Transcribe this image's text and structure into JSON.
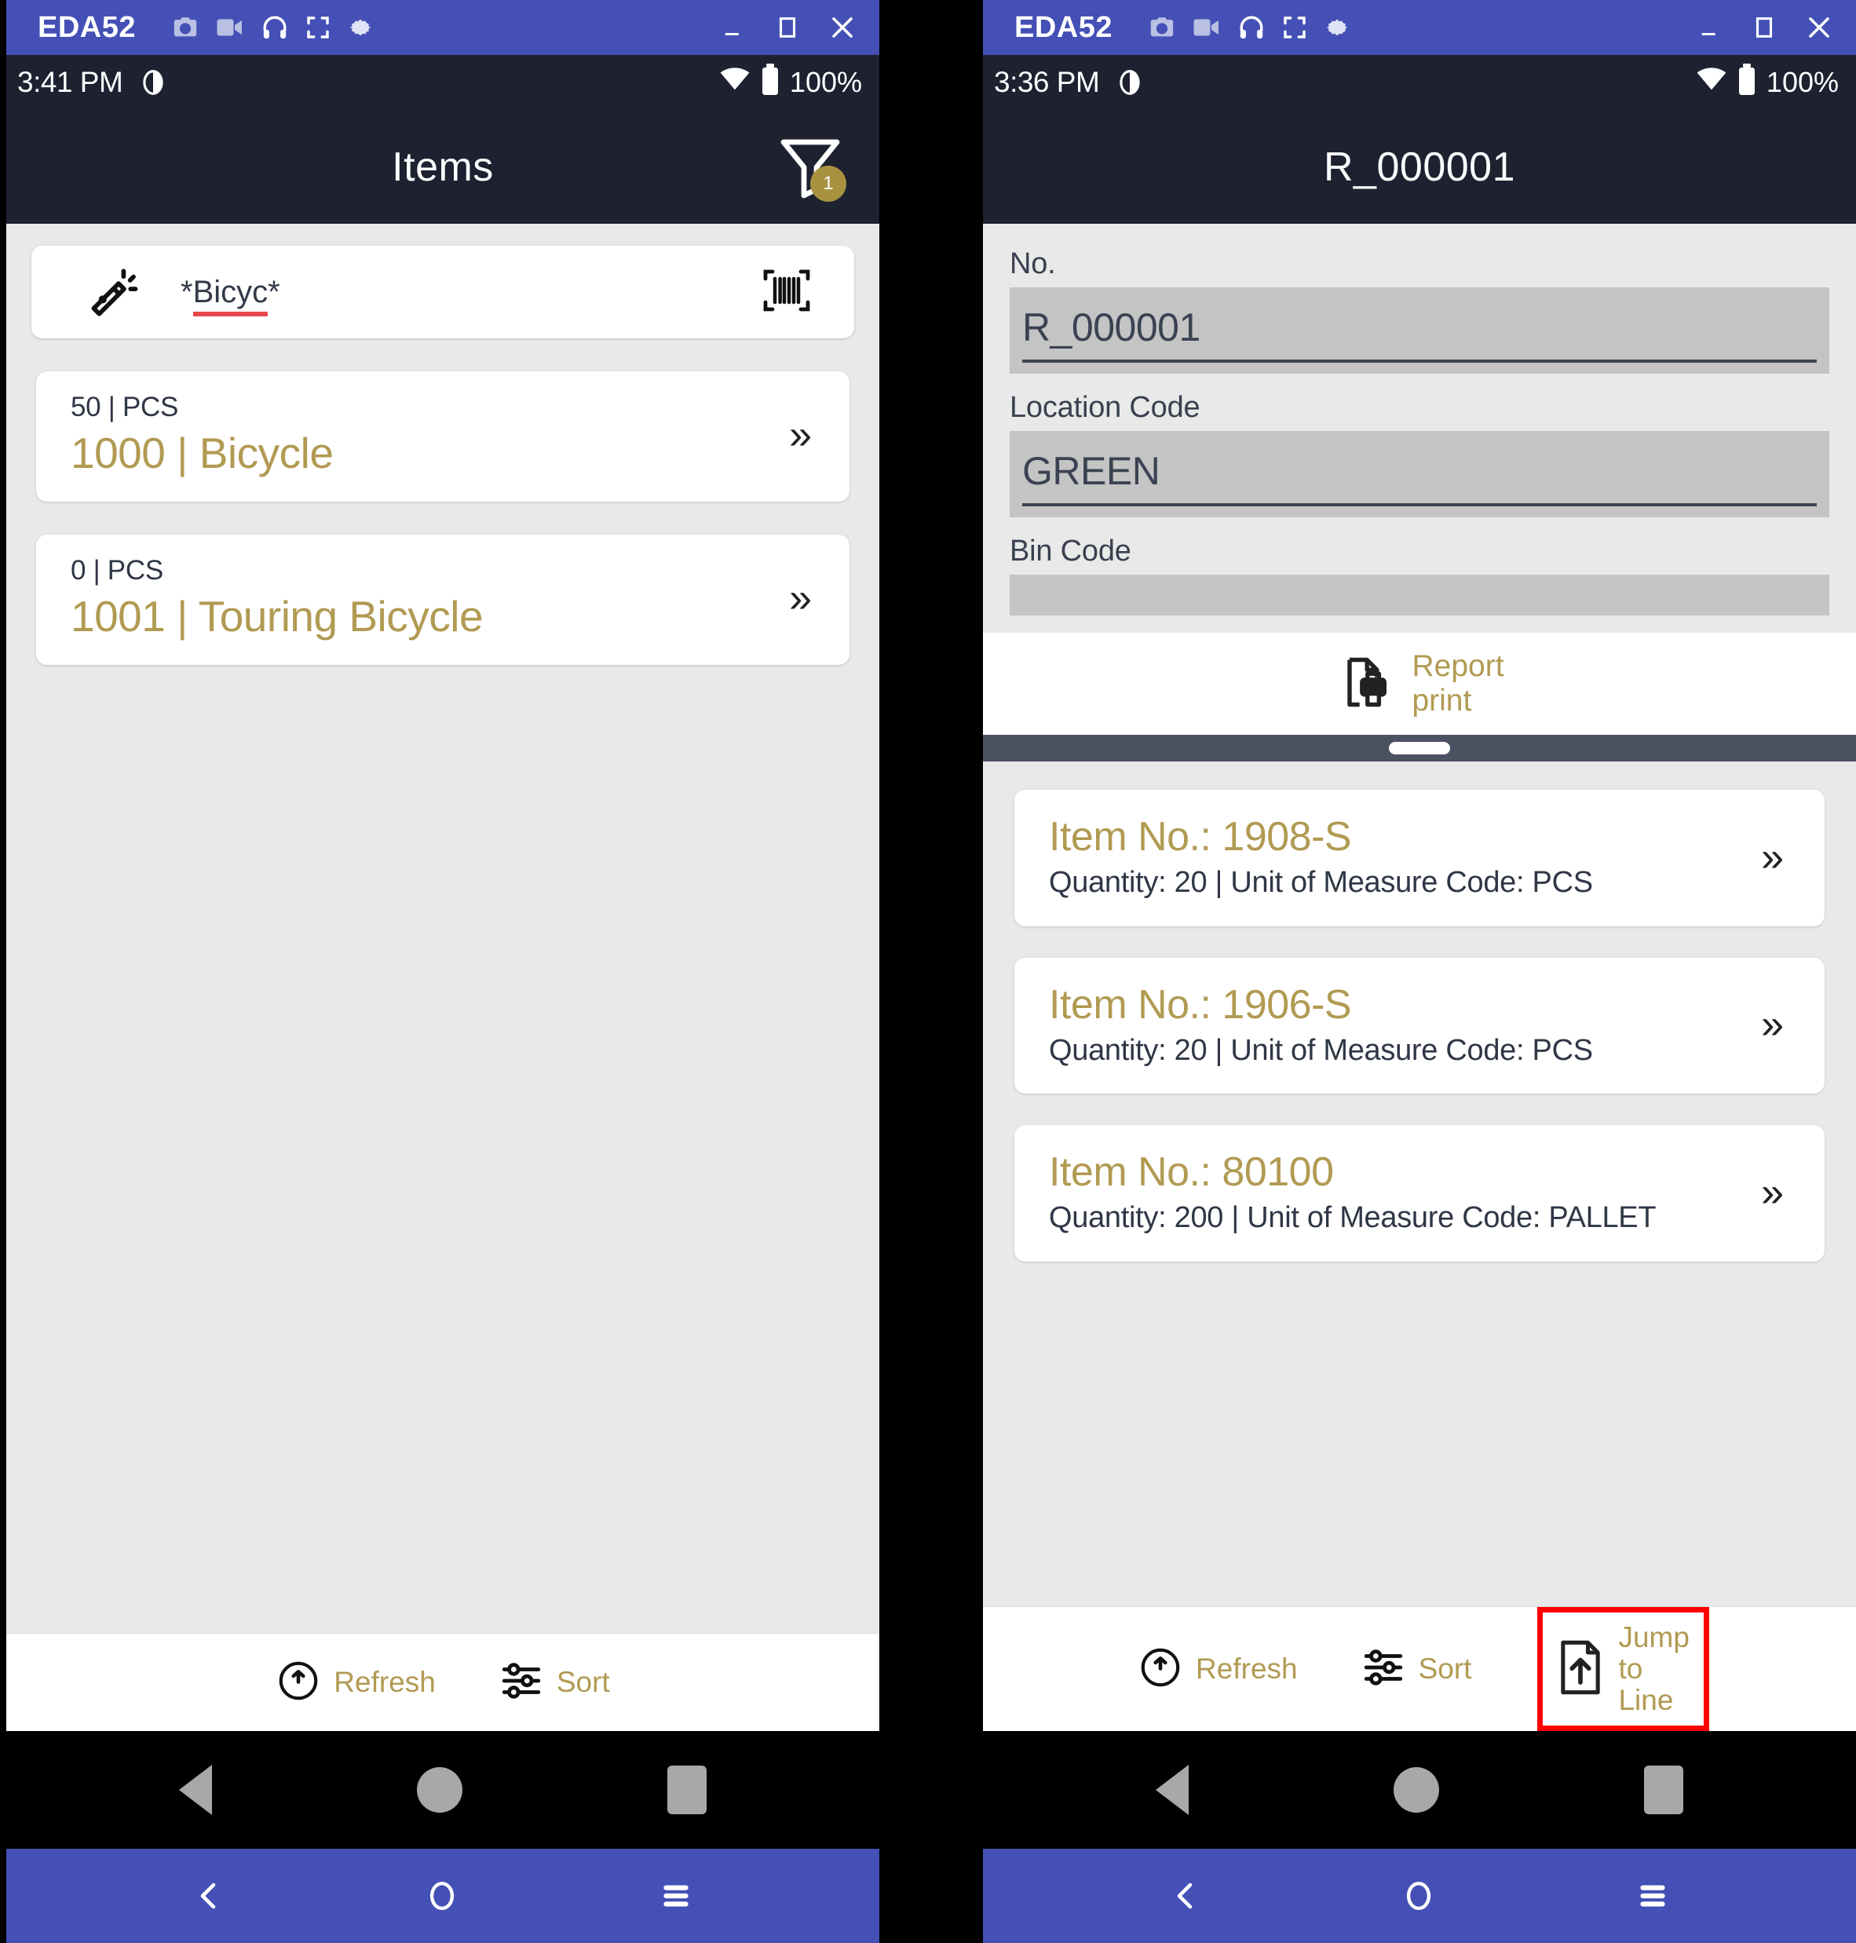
{
  "window": {
    "app_title": "EDA52",
    "toolbar_icons": [
      "camera-icon",
      "video-icon",
      "headphones-icon",
      "fullscreen-icon",
      "gear-icon"
    ],
    "controls": [
      "minimize-button",
      "maximize-button",
      "close-button"
    ]
  },
  "colors": {
    "accent_gold": "#b19a52",
    "appbar_navy": "#1d2130",
    "window_blue": "#4450b5",
    "highlight_red": "#ff0000",
    "spellcheck_red": "#e8474c",
    "field_gray": "#c4c4c4",
    "page_gray": "#e9e9e9"
  },
  "left_panel": {
    "status": {
      "time": "3:41 PM",
      "dnd_icon": "do-not-disturb-icon",
      "wifi_icon": "wifi-icon",
      "battery_icon": "battery-icon",
      "battery_level": "100%"
    },
    "header": {
      "title": "Items",
      "filter_icon": "filter-icon",
      "filter_badge": "1"
    },
    "scan": {
      "wand_icon": "magic-wand-icon",
      "value": "*Bicyc*",
      "spellcheck_part": "Bicyc",
      "barcode_icon": "barcode-scan-icon"
    },
    "items": [
      {
        "qty_line": "50 | PCS",
        "name_line": "1000 | Bicycle",
        "chevron": "»"
      },
      {
        "qty_line": "0 | PCS",
        "name_line": "1001 | Touring Bicycle",
        "chevron": "»"
      }
    ],
    "actions": [
      {
        "icon": "refresh-icon",
        "label": "Refresh"
      },
      {
        "icon": "sort-icon",
        "label": "Sort"
      }
    ]
  },
  "right_panel": {
    "status": {
      "time": "3:36 PM",
      "dnd_icon": "do-not-disturb-icon",
      "wifi_icon": "wifi-icon",
      "battery_icon": "battery-icon",
      "battery_level": "100%"
    },
    "header": {
      "title": "R_000001"
    },
    "form": {
      "fields": [
        {
          "label": "No.",
          "value": "R_000001"
        },
        {
          "label": "Location Code",
          "value": "GREEN"
        },
        {
          "label": "Bin Code",
          "value": ""
        }
      ]
    },
    "report": {
      "icon": "report-print-icon",
      "label_line1": "Report",
      "label_line2": "print"
    },
    "lines": [
      {
        "title": "Item No.: 1908-S",
        "sub": "Quantity: 20 | Unit of Measure Code: PCS",
        "chevron": "»"
      },
      {
        "title": "Item No.: 1906-S",
        "sub": "Quantity: 20 | Unit of Measure Code: PCS",
        "chevron": "»"
      },
      {
        "title": "Item No.: 80100",
        "sub": "Quantity: 200 | Unit of Measure Code: PALLET",
        "chevron": "»"
      }
    ],
    "actions": [
      {
        "icon": "refresh-icon",
        "label": "Refresh"
      },
      {
        "icon": "sort-icon",
        "label": "Sort"
      },
      {
        "icon": "jump-to-line-icon",
        "label_line1": "Jump",
        "label_line2": "to",
        "label_line3": "Line",
        "highlighted": true
      }
    ]
  }
}
